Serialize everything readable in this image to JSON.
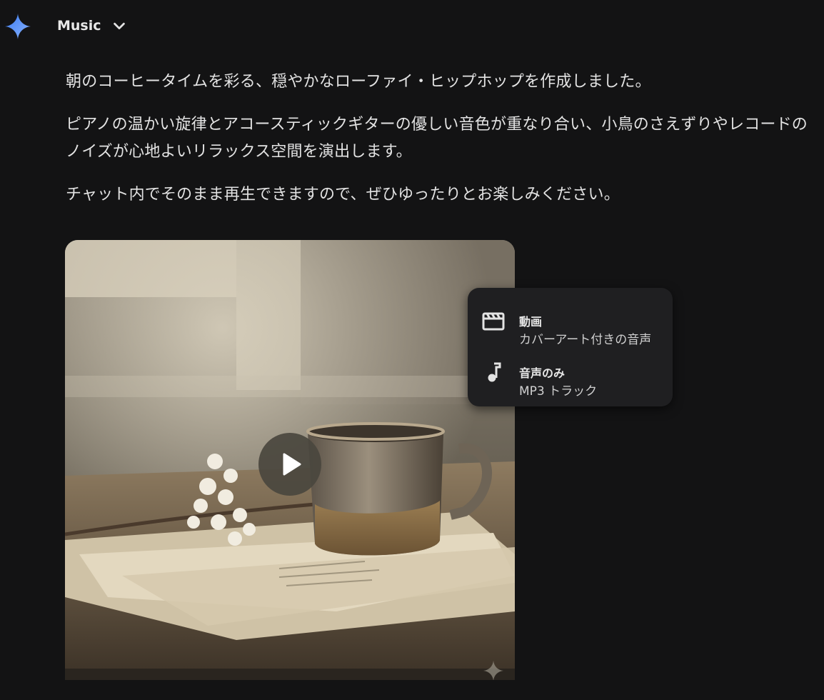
{
  "header": {
    "model_name": "Music"
  },
  "message": {
    "paragraphs": [
      "朝のコーヒータイムを彩る、穏やかなローファイ・ヒップホップを作成しました。",
      "ピアノの温かい旋律とアコースティックギターの優しい音色が重なり合い、小鳥のさえずりやレコードのノイズが心地よいリラックス空間を演出します。",
      "チャット内でそのまま再生できますので、ぜひゆったりとお楽しみください。"
    ]
  },
  "media": {
    "cover_icon": "play-icon"
  },
  "download_menu": {
    "items": [
      {
        "icon": "movie-icon",
        "title": "動画",
        "subtitle": "カバーアート付きの音声"
      },
      {
        "icon": "music-note-icon",
        "title": "音声のみ",
        "subtitle": "MP3 トラック"
      }
    ]
  },
  "colors": {
    "background": "#131314",
    "menu_background": "#1f1f21",
    "logo_blue": "#4f8df5",
    "text": "#e3e3e3"
  }
}
